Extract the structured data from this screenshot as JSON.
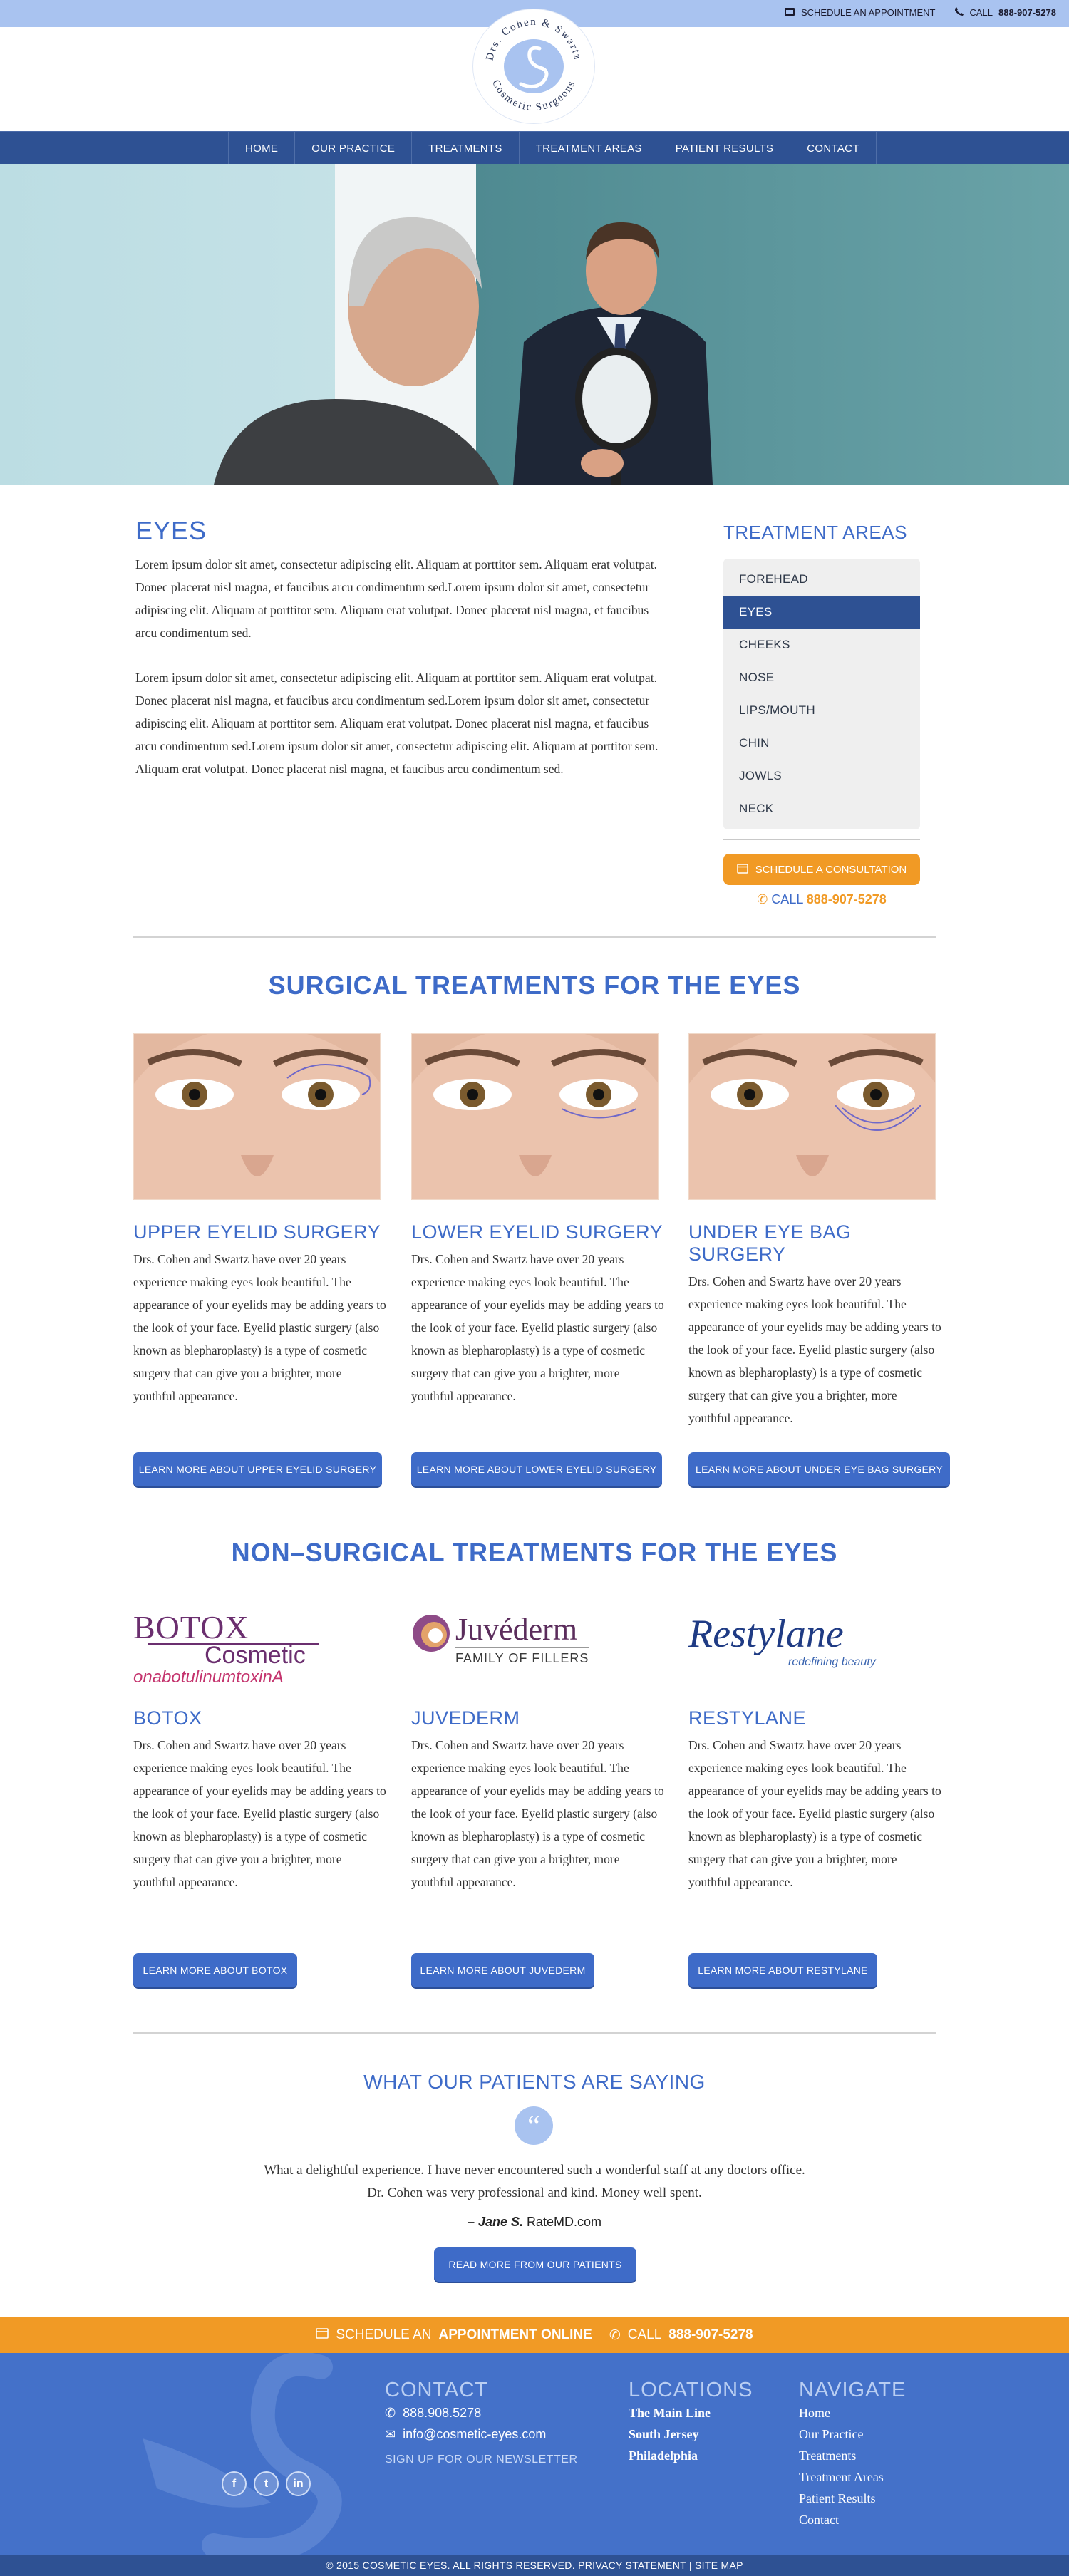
{
  "topbar": {
    "schedule_label": "SCHEDULE AN APPOINTMENT",
    "call_prefix": "CALL",
    "phone": "888-907-5278"
  },
  "logo": {
    "line1": "Drs. Cohen & Swartz",
    "line2": "Cosmetic Surgeons"
  },
  "nav": [
    "HOME",
    "OUR PRACTICE",
    "TREATMENTS",
    "TREATMENT AREAS",
    "PATIENT RESULTS",
    "CONTACT"
  ],
  "page": {
    "title": "EYES",
    "paragraphs": [
      "Lorem ipsum dolor sit amet, consectetur adipiscing elit. Aliquam at porttitor sem. Aliquam erat volutpat. Donec placerat nisl magna, et faucibus arcu condimentum sed.Lorem ipsum dolor sit amet, consectetur adipiscing elit. Aliquam at porttitor sem. Aliquam erat volutpat. Donec placerat nisl magna, et faucibus arcu condimentum sed.",
      "Lorem ipsum dolor sit amet, consectetur adipiscing elit. Aliquam at porttitor sem. Aliquam erat volutpat. Donec placerat nisl magna, et faucibus arcu condimentum sed.Lorem ipsum dolor sit amet, consectetur adipiscing elit. Aliquam at porttitor sem. Aliquam erat volutpat. Donec placerat nisl magna, et faucibus arcu condimentum sed.Lorem ipsum dolor sit amet, consectetur adipiscing elit. Aliquam at porttitor sem. Aliquam erat volutpat. Donec placerat nisl magna, et faucibus arcu condimentum sed."
    ]
  },
  "sidebar": {
    "title": "TREATMENT AREAS",
    "items": [
      "FOREHEAD",
      "EYES",
      "CHEEKS",
      "NOSE",
      "LIPS/MOUTH",
      "CHIN",
      "JOWLS",
      "NECK"
    ],
    "active": "EYES",
    "consult_label": "SCHEDULE A CONSULTATION",
    "call_prefix": "CALL",
    "phone": "888-907-5278"
  },
  "surgical": {
    "title": "SURGICAL TREATMENTS FOR THE EYES",
    "cards": [
      {
        "title": "UPPER EYELID SURGERY",
        "text": "Drs. Cohen and Swartz  have over 20 years experience making eyes look beautiful. The appearance of your eyelids may be adding years to the look of your face. Eyelid plastic surgery (also known as blepharoplasty) is a type of cosmetic surgery that can give you a brighter, more youthful appearance.",
        "button": "LEARN MORE ABOUT UPPER EYELID SURGERY"
      },
      {
        "title": "LOWER EYELID SURGERY",
        "text": "Drs. Cohen and Swartz  have over 20 years experience making eyes look beautiful. The appearance of your eyelids may be adding years to the look of your face. Eyelid plastic surgery (also known as blepharoplasty) is a type of cosmetic surgery that can give you a brighter, more youthful appearance.",
        "button": "LEARN MORE ABOUT LOWER EYELID SURGERY"
      },
      {
        "title": "UNDER EYE BAG SURGERY",
        "text": "Drs. Cohen and Swartz  have over 20 years experience making eyes look beautiful. The appearance of your eyelids may be adding years to the look of your face. Eyelid plastic surgery (also known as blepharoplasty) is a type of cosmetic surgery that can give you a brighter, more youthful appearance.",
        "button": "LEARN MORE ABOUT UNDER EYE BAG SURGERY"
      }
    ]
  },
  "nonsurgical": {
    "title": "NON–SURGICAL TREATMENTS FOR THE EYES",
    "cards": [
      {
        "title": "BOTOX",
        "logo_lines": [
          "BOTOX",
          "Cosmetic",
          "onabotulinumtoxinA"
        ],
        "text": "Drs. Cohen and Swartz  have over 20 years experience making eyes look beautiful. The appearance of your eyelids may be adding years to the look of your face. Eyelid plastic surgery (also known as blepharoplasty) is a type of cosmetic surgery that can give you a brighter, more youthful appearance.",
        "button": "LEARN MORE ABOUT BOTOX"
      },
      {
        "title": "JUVEDERM",
        "logo_lines": [
          "Juvéderm",
          "FAMILY OF FILLERS"
        ],
        "text": "Drs. Cohen and Swartz  have over 20 years experience making eyes look beautiful. The appearance of your eyelids may be adding years to the look of your face. Eyelid plastic surgery (also known as blepharoplasty) is a type of cosmetic surgery that can give you a brighter, more youthful appearance.",
        "button": "LEARN MORE ABOUT JUVEDERM"
      },
      {
        "title": "RESTYLANE",
        "logo_lines": [
          "Restylane",
          "redefining beauty"
        ],
        "text": "Drs. Cohen and Swartz  have over 20 years experience making eyes look beautiful. The appearance of your eyelids may be adding years to the look of your face. Eyelid plastic surgery (also known as blepharoplasty) is a type of cosmetic surgery that can give you a brighter, more youthful appearance.",
        "button": "LEARN MORE ABOUT RESTYLANE"
      }
    ]
  },
  "testimonials": {
    "title": "WHAT OUR PATIENTS ARE SAYING",
    "quote": "What a delightful experience. I have never encountered such a wonderful staff at any doctors office. Dr. Cohen was very professional and kind. Money well spent.",
    "author": "– Jane S.",
    "source": "RateMD.com",
    "button": "READ MORE FROM OUR PATIENTS"
  },
  "footer_cta": {
    "schedule_prefix": "SCHEDULE AN",
    "schedule_bold": "APPOINTMENT ONLINE",
    "call_prefix": "CALL",
    "phone": "888-907-5278"
  },
  "footer": {
    "contact": {
      "title": "CONTACT",
      "phone": "888.908.5278",
      "email": "info@cosmetic-eyes.com",
      "newsletter": "SIGN UP FOR OUR NEWSLETTER"
    },
    "locations": {
      "title": "LOCATIONS",
      "items": [
        "The Main Line",
        "South Jersey",
        "Philadelphia"
      ]
    },
    "navigate": {
      "title": "NAVIGATE",
      "items": [
        "Home",
        "Our Practice",
        "Treatments",
        "Treatment Areas",
        "Patient Results",
        "Contact"
      ]
    },
    "social": [
      "f",
      "t",
      "in"
    ]
  },
  "copyright": "© 2015 COSMETIC EYES. ALL RIGHTS RESERVED. PRIVACY STATEMENT | SITE MAP",
  "colors": {
    "primary": "#3e6bc8",
    "nav": "#2e5193",
    "accent": "#f19a25",
    "topbar": "#a9c3f0"
  }
}
